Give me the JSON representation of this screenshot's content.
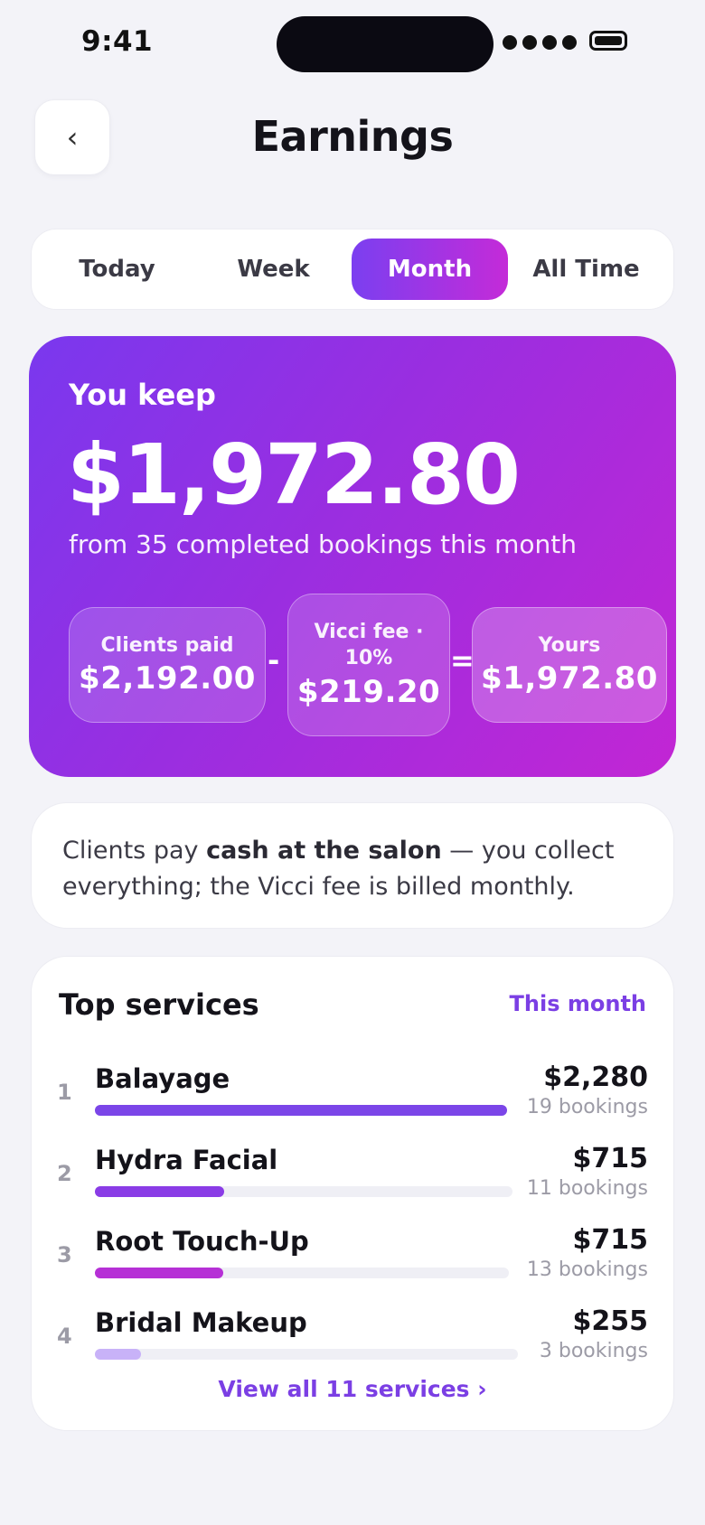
{
  "status_bar": {
    "time": "9:41"
  },
  "header": {
    "back_icon": "chevron-left-icon",
    "back_glyph": "‹",
    "title": "Earnings"
  },
  "tabs": [
    {
      "label": "Today",
      "active": false
    },
    {
      "label": "Week",
      "active": false
    },
    {
      "label": "Month",
      "active": true
    },
    {
      "label": "All Time",
      "active": false
    }
  ],
  "hero": {
    "label": "You keep",
    "amount": "$1,972.80",
    "subtitle": "from 35 completed bookings this month",
    "breakdown": {
      "paid_label": "Clients paid",
      "paid_value": "$2,192.00",
      "minus": "-",
      "fee_label": "Vicci fee · 10%",
      "fee_value": "$219.20",
      "equals": "=",
      "yours_label": "Yours",
      "yours_value": "$1,972.80"
    }
  },
  "info": {
    "text_before": "Clients pay ",
    "text_bold": "cash at the salon",
    "text_after": " — you collect everything; the Vicci fee is billed monthly."
  },
  "top_services": {
    "title": "Top services",
    "period": "This month",
    "items": [
      {
        "rank": "1",
        "name": "Balayage",
        "amount": "$2,280",
        "bookings": "19 bookings",
        "share": 1.0,
        "color": "#7B45E8"
      },
      {
        "rank": "2",
        "name": "Hydra Facial",
        "amount": "$715",
        "bookings": "11 bookings",
        "share": 0.31,
        "color": "#8A3CE6"
      },
      {
        "rank": "3",
        "name": "Root Touch-Up",
        "amount": "$715",
        "bookings": "13 bookings",
        "share": 0.31,
        "color": "#B630D6"
      },
      {
        "rank": "4",
        "name": "Bridal Makeup",
        "amount": "$255",
        "bookings": "3 bookings",
        "share": 0.11,
        "color": "#C8B2F8"
      }
    ],
    "view_all": "View all 11 services ›"
  },
  "colors": {
    "accent": "#7B3FE4",
    "gradient_start": "#7A38EE",
    "gradient_end": "#C226D4",
    "background": "#F3F3F8"
  }
}
